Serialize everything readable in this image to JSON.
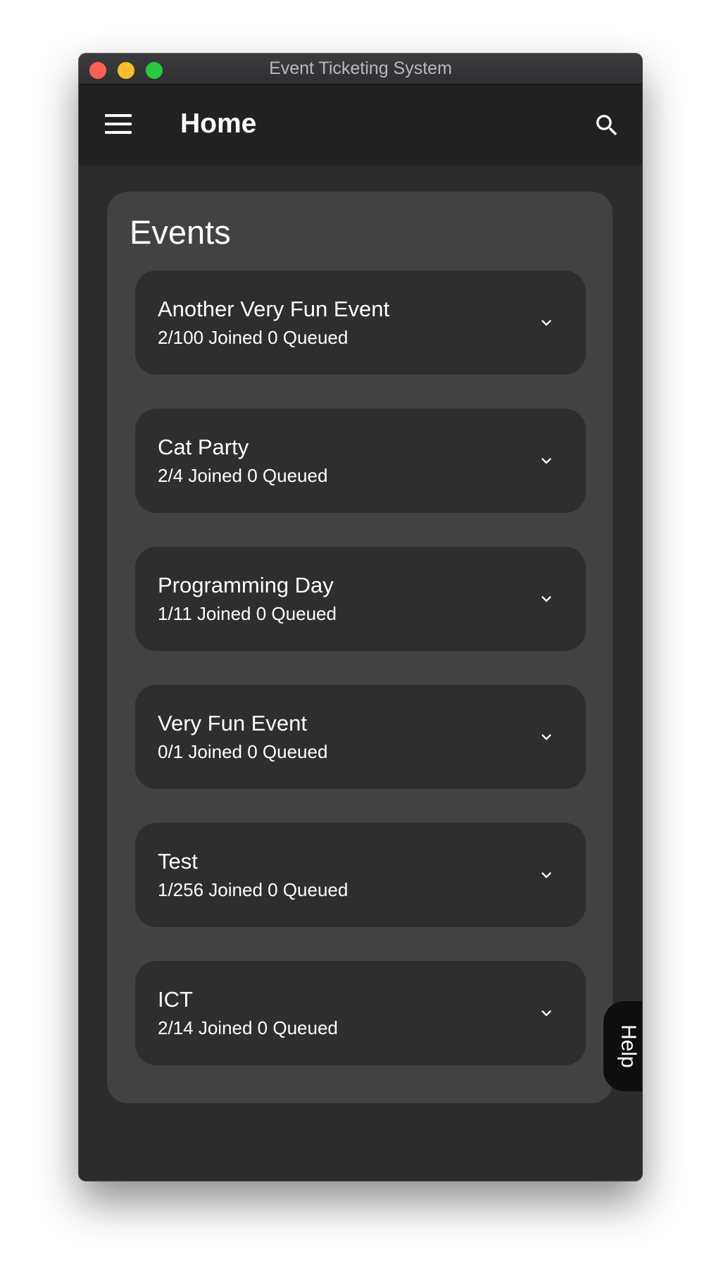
{
  "window": {
    "title": "Event Ticketing System"
  },
  "appbar": {
    "title": "Home",
    "menu_icon": "hamburger-menu-icon",
    "search_icon": "search-icon"
  },
  "events": {
    "heading": "Events",
    "items": [
      {
        "name": "Another Very Fun Event",
        "stats": "2/100 Joined 0 Queued"
      },
      {
        "name": "Cat Party",
        "stats": "2/4 Joined 0 Queued"
      },
      {
        "name": "Programming Day",
        "stats": "1/11 Joined 0 Queued"
      },
      {
        "name": "Very Fun Event",
        "stats": "0/1 Joined 0 Queued"
      },
      {
        "name": "Test",
        "stats": "1/256 Joined 0 Queued"
      },
      {
        "name": "ICT",
        "stats": "2/14 Joined 0 Queued"
      }
    ],
    "expand_icon": "chevron-down-icon"
  },
  "help": {
    "label": "Help"
  },
  "colors": {
    "window_background": "#2c2c2c",
    "appbar_background": "#212121",
    "panel_background": "#424242",
    "card_background": "#2e2e2e",
    "help_tab_background": "#0e0e0e",
    "text": "#ffffff",
    "traffic_close": "#fe5f57",
    "traffic_minimize": "#febc2e",
    "traffic_maximize": "#28c840"
  }
}
